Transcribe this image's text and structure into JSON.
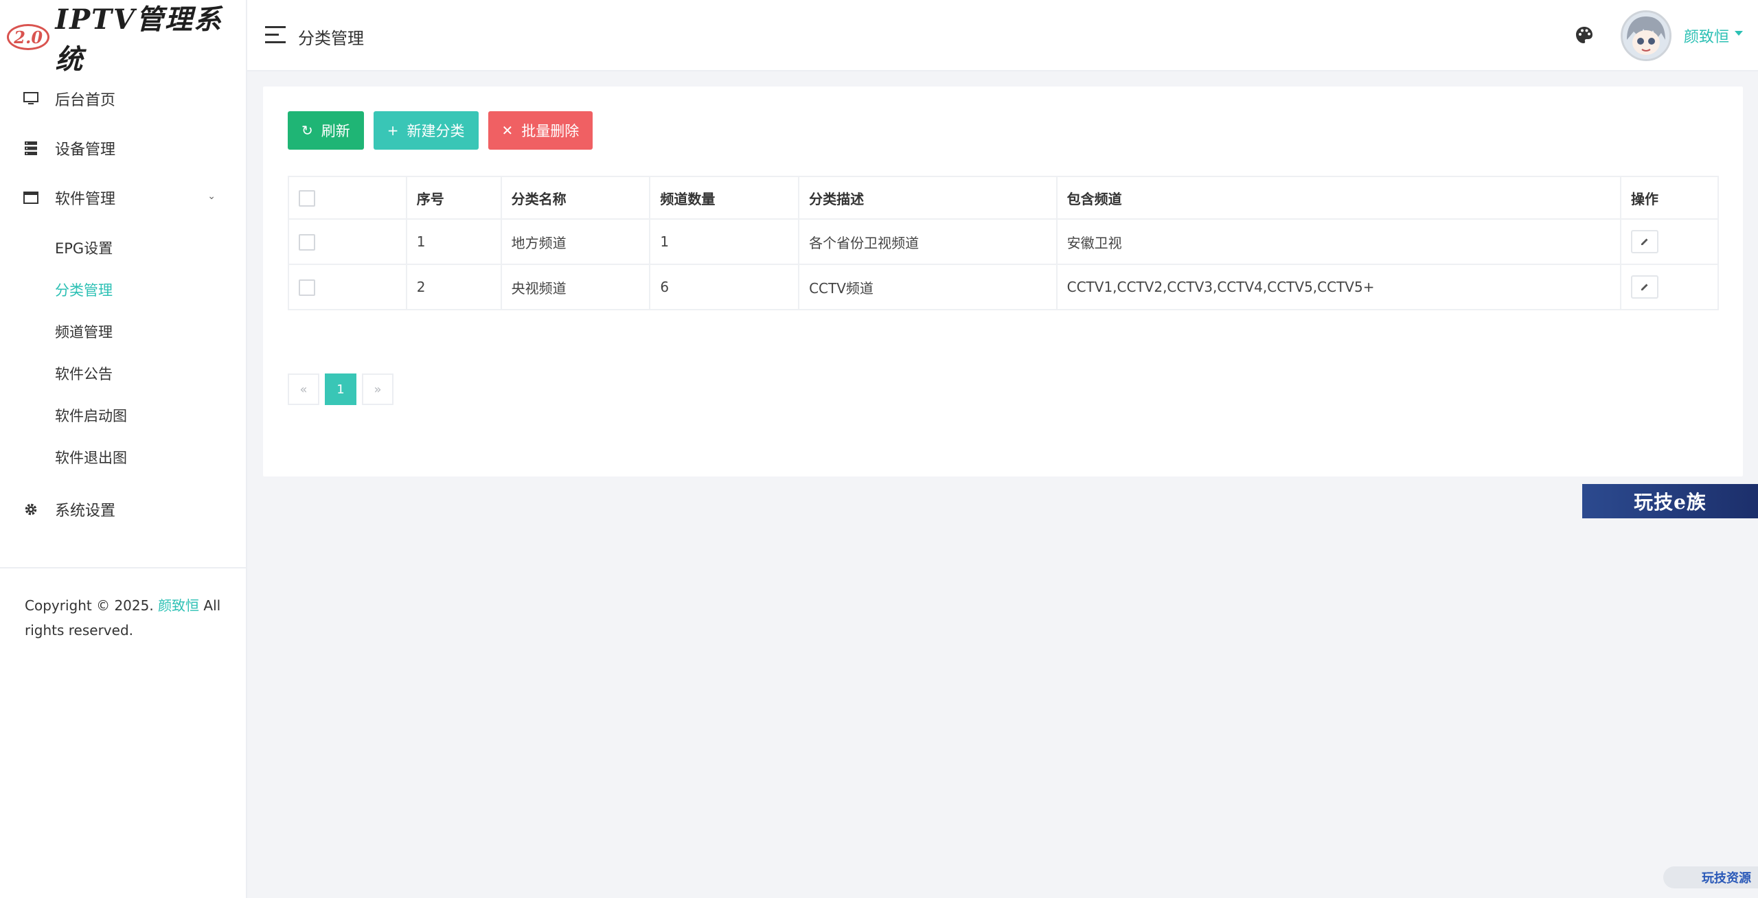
{
  "logo": {
    "badge": "2.0",
    "title": "IPTV管理系统"
  },
  "sidebar": {
    "items": [
      {
        "label": "后台首页",
        "icon": "monitor-icon"
      },
      {
        "label": "设备管理",
        "icon": "server-icon"
      },
      {
        "label": "软件管理",
        "icon": "window-icon",
        "expanded": true
      }
    ],
    "submenu": [
      {
        "label": "EPG设置"
      },
      {
        "label": "分类管理",
        "active": true
      },
      {
        "label": "频道管理"
      },
      {
        "label": "软件公告"
      },
      {
        "label": "软件启动图"
      },
      {
        "label": "软件退出图"
      }
    ],
    "settings": {
      "label": "系统设置",
      "icon": "gear-icon"
    },
    "copyright": {
      "prefix": "Copyright © 2025.",
      "owner": "颜致恒",
      "suffix": "All rights reserved."
    }
  },
  "header": {
    "title": "分类管理",
    "user_name": "颜致恒"
  },
  "toolbar": {
    "refresh_label": "刷新",
    "new_label": "新建分类",
    "delete_label": "批量删除"
  },
  "table": {
    "headers": [
      "序号",
      "分类名称",
      "频道数量",
      "分类描述",
      "包含频道",
      "操作"
    ],
    "rows": [
      {
        "id": "1",
        "name": "地方频道",
        "count": "1",
        "desc": "各个省份卫视频道",
        "channels": "安徽卫视"
      },
      {
        "id": "2",
        "name": "央视频道",
        "count": "6",
        "desc": "CCTV频道",
        "channels": "CCTV1,CCTV2,CCTV3,CCTV4,CCTV5,CCTV5+"
      }
    ]
  },
  "pagination": {
    "prev": "«",
    "current": "1",
    "next": "»"
  },
  "watermark": {
    "banner": "玩技e族",
    "corner": "玩技资源"
  },
  "colors": {
    "accent": "#2cc0b4",
    "green": "#1fb575",
    "teal": "#39c6b6",
    "red": "#f06063"
  }
}
